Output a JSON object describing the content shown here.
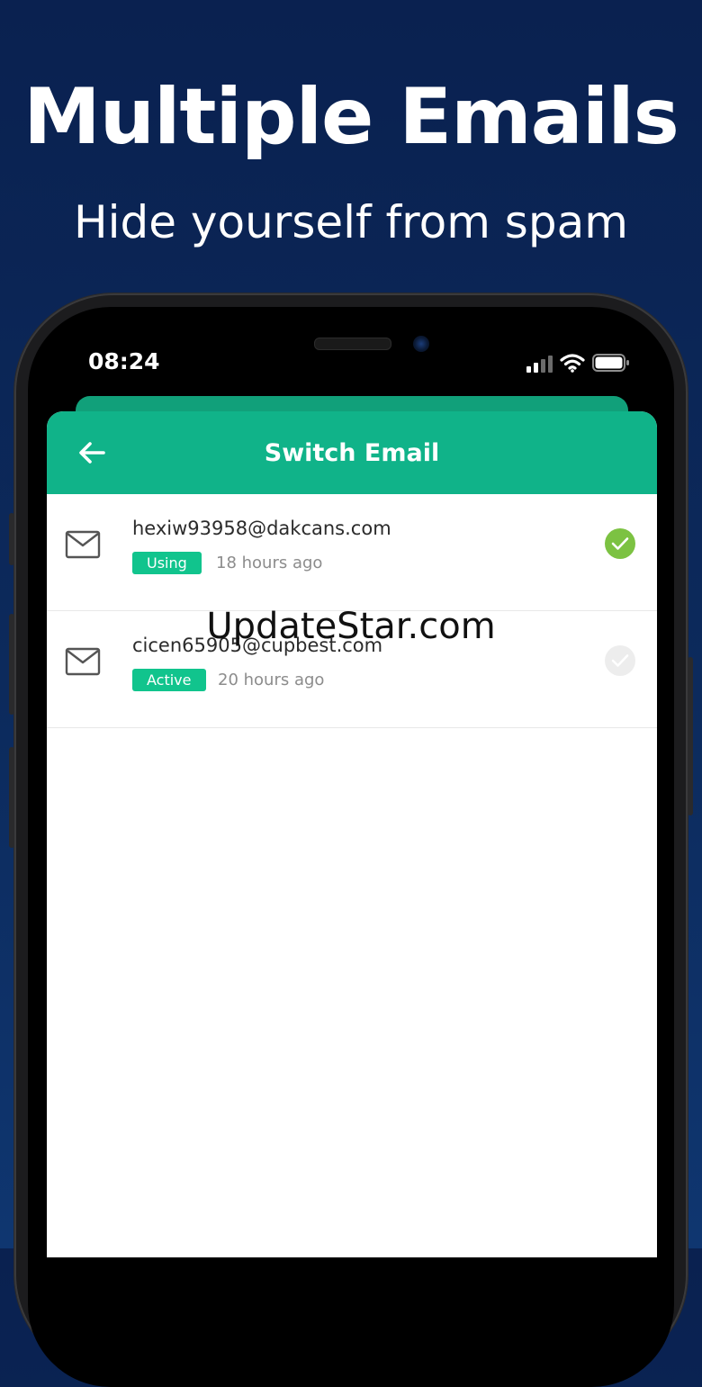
{
  "promo": {
    "title": "Multiple Emails",
    "subtitle": "Hide yourself from spam"
  },
  "status_bar": {
    "time": "08:24",
    "icons": [
      "signal-icon",
      "wifi-icon",
      "battery-icon"
    ]
  },
  "header": {
    "title": "Switch Email",
    "back_icon": "arrow-left-icon"
  },
  "emails": [
    {
      "address": "hexiw93958@dakcans.com",
      "badge": "Using",
      "time": "18 hours ago",
      "selected": true
    },
    {
      "address": "cicen65905@cupbest.com",
      "badge": "Active",
      "time": "20 hours ago",
      "selected": false
    }
  ],
  "watermark": "UpdateStar.com",
  "colors": {
    "background": "#0c2a5c",
    "header": "#10b389",
    "badge": "#11c48d",
    "check_selected": "#7cc242",
    "check_unselected": "#ededed"
  }
}
